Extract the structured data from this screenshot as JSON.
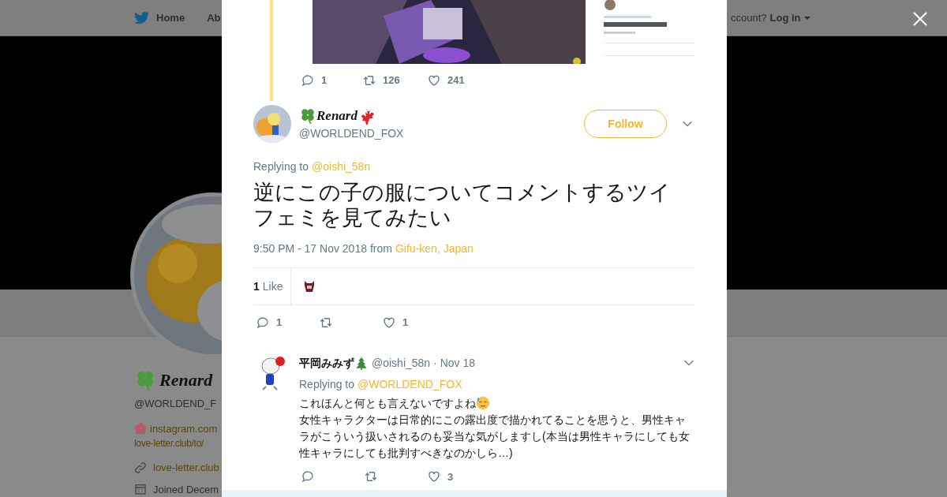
{
  "background_page": {
    "nav": {
      "items": [
        {
          "label": "Home",
          "kind": "bird"
        },
        {
          "label": "Ab",
          "kind": "plain"
        }
      ],
      "login_prompt": "ccount?",
      "login": "Log in"
    },
    "profile": {
      "name": "Renard",
      "handle": "@WORLDEND_F",
      "bio_link": "instagram.com",
      "bio_line": "love-letter.club/to/",
      "website": "love-letter.club",
      "joined": "Joined Decem"
    }
  },
  "quoted_thread": {
    "actions": [
      {
        "kind": "reply",
        "count": "1"
      },
      {
        "kind": "retweet",
        "count": "126"
      },
      {
        "kind": "like",
        "count": "241"
      }
    ]
  },
  "tweet": {
    "name": "Renard",
    "handle": "@WORLDEND_FOX",
    "follow": "Follow",
    "replying_label": "Replying to",
    "replying_to": "@oishi_58n",
    "text": "逆にこの子の服についてコメントするツイフェミを見てみたい",
    "time": "9:50 PM - 17 Nov 2018",
    "from_label": "from",
    "place": "Gifu-ken, Japan",
    "likes_count": "1",
    "likes_label": "Like",
    "actions": [
      {
        "kind": "reply",
        "count": "1"
      },
      {
        "kind": "retweet"
      },
      {
        "kind": "like",
        "count": "1"
      }
    ]
  },
  "replies": [
    {
      "name": "平岡みみず",
      "handle": "@oishi_58n",
      "date": "· Nov 18",
      "replying_label": "Replying to",
      "replying_to": "@WORLDEND_FOX",
      "first_line": "これほんと何とも言えないですよね",
      "text": "女性キャラクターは日常的にこの露出度で描かれてることを思うと、男性キャラがこういう扱いされるのも妥当な気がしますし(本当は男性キャラにしても女性キャラにしても批判すべきなのかしら…)",
      "actions": [
        {
          "kind": "reply"
        },
        {
          "kind": "retweet"
        },
        {
          "kind": "like",
          "count": "3"
        }
      ]
    }
  ]
}
